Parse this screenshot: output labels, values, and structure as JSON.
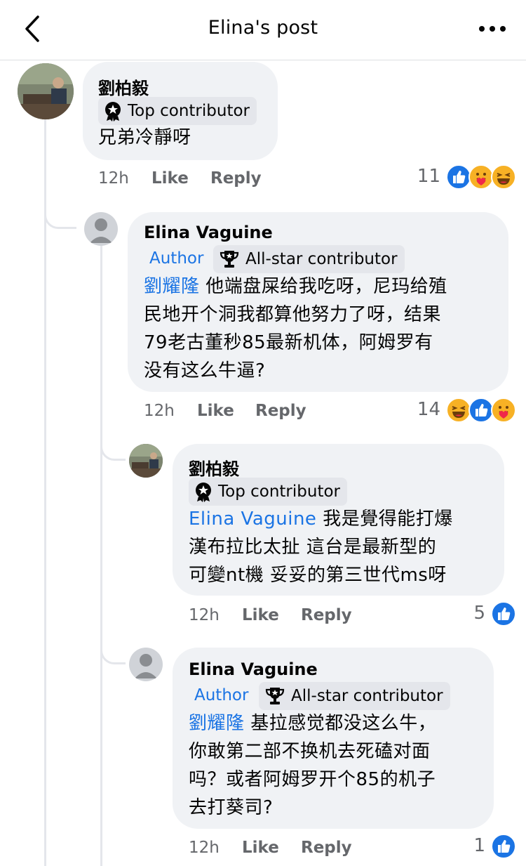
{
  "header": {
    "title": "Elina's post"
  },
  "comments": [
    {
      "name": "劉柏毅",
      "badge": "Top contributor",
      "text": "兄弟冷靜呀",
      "time": "12h",
      "like": "Like",
      "reply": "Reply",
      "reactions": "11"
    },
    {
      "name": "Elina Vaguine",
      "author": "Author",
      "badge": "All-star contributor",
      "mention": "劉耀隆",
      "line1": " 他端盘屎给我吃呀，尼玛给殖",
      "line2": "民地开个洞我都算他努力了呀，结果",
      "line3": "79老古董秒85最新机体，阿姆罗有",
      "line4": "没有这么牛逼?",
      "time": "12h",
      "like": "Like",
      "reply": "Reply",
      "reactions": "14"
    },
    {
      "name": "劉柏毅",
      "badge": "Top contributor",
      "mention": "Elina Vaguine",
      "line1": " 我是覺得能打爆",
      "line2": "漢布拉比太扯 這台是最新型的",
      "line3": "可變nt機 妥妥的第三世代ms呀",
      "time": "12h",
      "like": "Like",
      "reply": "Reply",
      "reactions": "5"
    },
    {
      "name": "Elina Vaguine",
      "author": "Author",
      "badge": "All-star contributor",
      "mention": "劉耀隆",
      "line1": " 基拉感觉都没这么牛，",
      "line2": "你敢第二部不换机去死磕对面",
      "line3": "吗？或者阿姆罗开个85的机子",
      "line4": "去打葵司?",
      "time": "12h",
      "like": "Like",
      "reply": "Reply",
      "reactions": "1"
    }
  ],
  "colors": {
    "accent": "#1b74e4",
    "bubble": "#f0f2f5",
    "badge": "#e4e6eb",
    "meta": "#65676b"
  }
}
